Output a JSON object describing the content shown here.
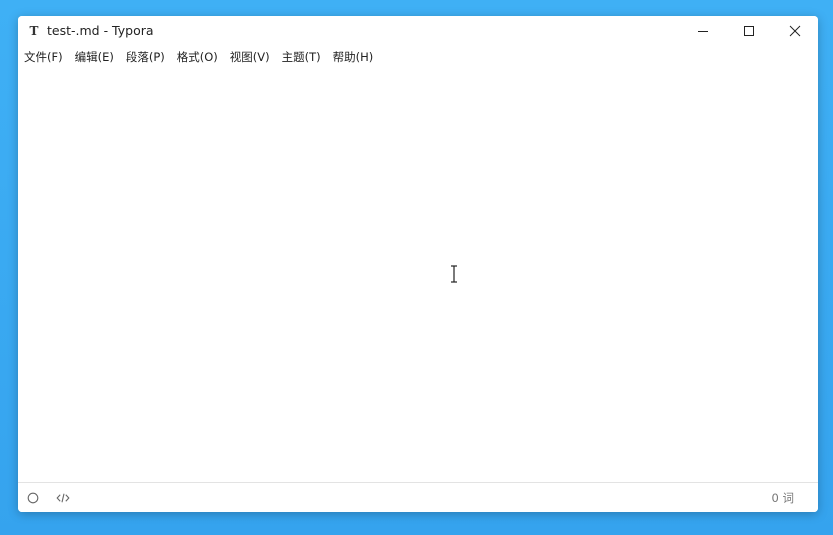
{
  "window": {
    "title": "test-.md - Typora",
    "app_icon_glyph": "T"
  },
  "window_controls": {
    "minimize_icon": "minimize-icon",
    "maximize_icon": "maximize-icon",
    "close_icon": "close-icon"
  },
  "menu": {
    "items": [
      {
        "label": "文件(F)"
      },
      {
        "label": "编辑(E)"
      },
      {
        "label": "段落(P)"
      },
      {
        "label": "格式(O)"
      },
      {
        "label": "视图(V)"
      },
      {
        "label": "主题(T)"
      },
      {
        "label": "帮助(H)"
      }
    ]
  },
  "editor": {
    "content": ""
  },
  "statusbar": {
    "word_count": "0 词",
    "sidebar_toggle_icon": "circle-icon",
    "source_mode_icon": "code-icon"
  },
  "colors": {
    "desktop": "#3aa8f0",
    "window_bg": "#ffffff",
    "text": "#222222",
    "muted_text": "#777777"
  }
}
